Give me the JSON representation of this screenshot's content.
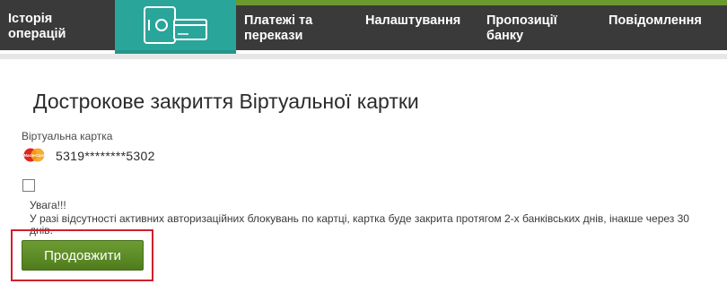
{
  "nav": {
    "history": [
      "Історія",
      "операцій"
    ],
    "payments": [
      "Платежі та",
      "перекази"
    ],
    "settings": "Налаштування",
    "offers": [
      "Пропозиції",
      "банку"
    ],
    "messages": "Повідомлення"
  },
  "page": {
    "title": "Дострокове закриття Віртуальної картки"
  },
  "card": {
    "label": "Віртуальна картка",
    "brand": "MasterCard",
    "number": "5319********5302"
  },
  "warning": {
    "title": "Увага!!!",
    "text": "У разі відсутності активних авторизаційних блокувань по картці, картка буде закрита протягом 2-х банківських днів, інакше через 30 днів."
  },
  "actions": {
    "continue_label": "Продовжити"
  },
  "colors": {
    "nav_bg": "#3a3a3a",
    "nav_active": "#2aa59a",
    "accent_green": "#6a9a2e",
    "button_green": "#5d8c27",
    "highlight_red": "#d0202a"
  },
  "icons": {
    "active_tab": "safe-with-card-icon",
    "card_brand": "mastercard-icon"
  }
}
